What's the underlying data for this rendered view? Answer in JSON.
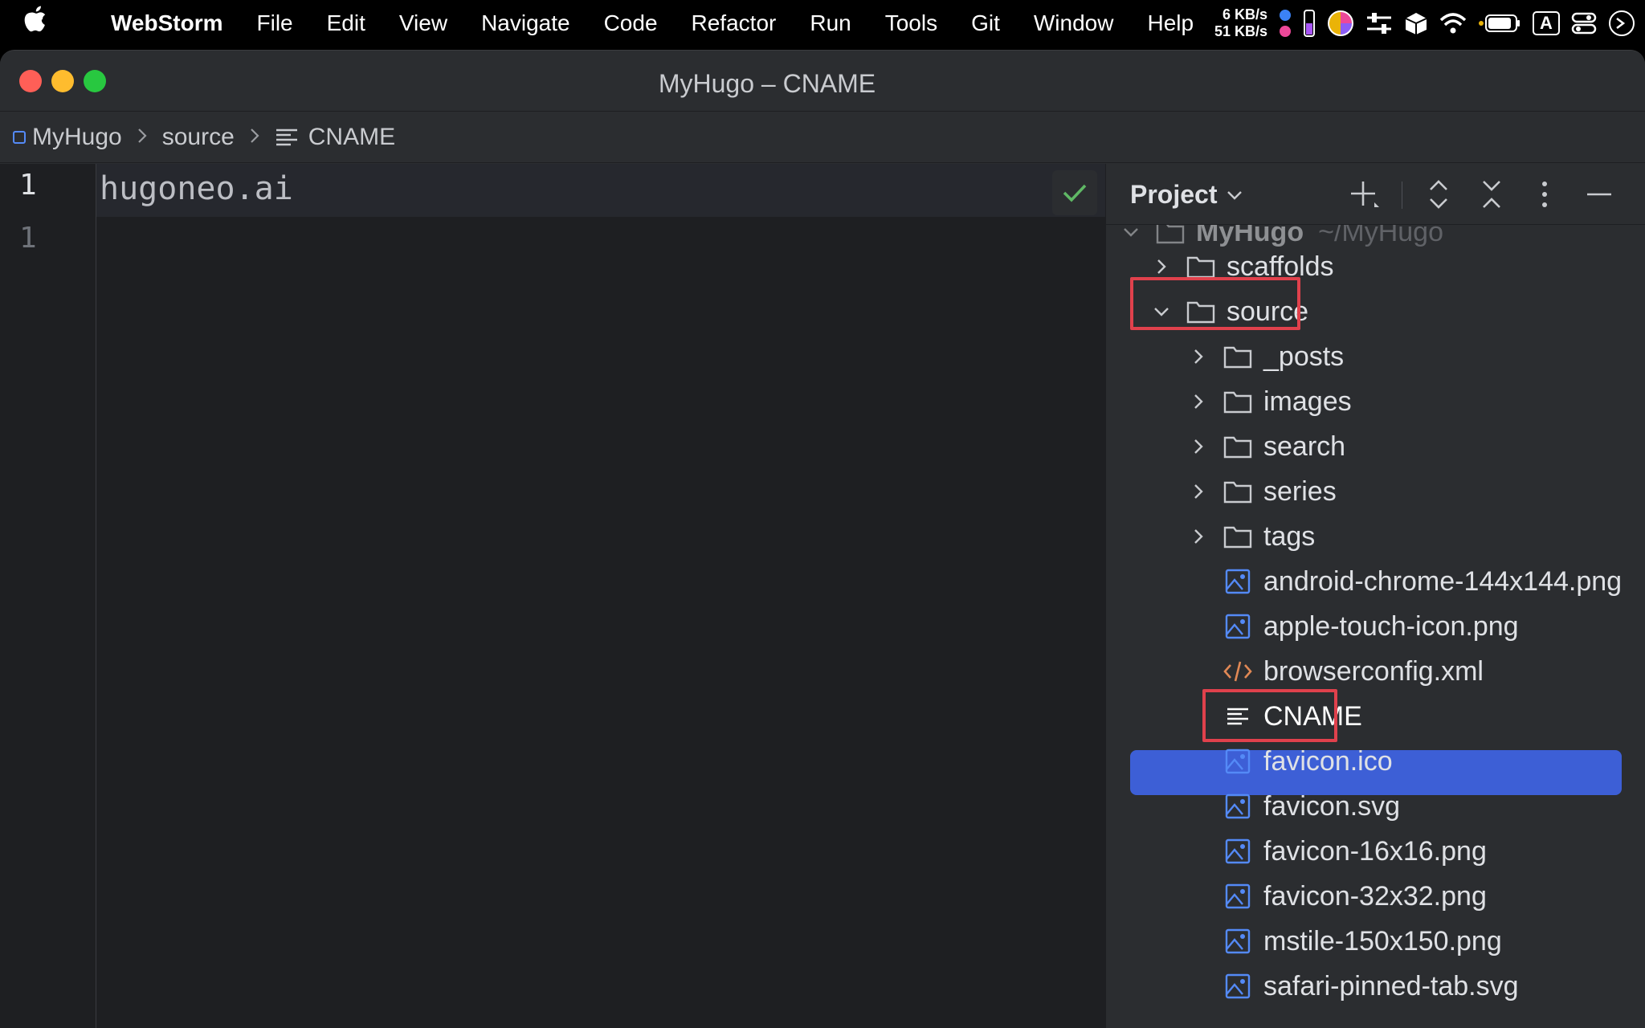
{
  "menubar": {
    "app_name": "WebStorm",
    "items": [
      "File",
      "Edit",
      "View",
      "Navigate",
      "Code",
      "Refactor",
      "Run",
      "Tools",
      "Git",
      "Window",
      "Help"
    ],
    "net_up": "6 KB/s",
    "net_down": "51 KB/s",
    "input_source": "A"
  },
  "window": {
    "title": "MyHugo – CNAME"
  },
  "breadcrumb": {
    "project": "MyHugo",
    "folder": "source",
    "file": "CNAME"
  },
  "editor": {
    "line_numbers": [
      "1",
      "1"
    ],
    "content": "hugoneo.ai"
  },
  "project_panel": {
    "title": "Project",
    "root_name": "MyHugo",
    "root_path": "~/MyHugo",
    "items": [
      {
        "label": "scaffolds",
        "type": "folder"
      },
      {
        "label": "source",
        "type": "folder"
      },
      {
        "label": "_posts",
        "type": "folder"
      },
      {
        "label": "images",
        "type": "folder"
      },
      {
        "label": "search",
        "type": "folder"
      },
      {
        "label": "series",
        "type": "folder"
      },
      {
        "label": "tags",
        "type": "folder"
      },
      {
        "label": "android-chrome-144x144.png",
        "type": "image"
      },
      {
        "label": "apple-touch-icon.png",
        "type": "image"
      },
      {
        "label": "browserconfig.xml",
        "type": "xml"
      },
      {
        "label": "CNAME",
        "type": "text"
      },
      {
        "label": "favicon.ico",
        "type": "image"
      },
      {
        "label": "favicon.svg",
        "type": "image"
      },
      {
        "label": "favicon-16x16.png",
        "type": "image"
      },
      {
        "label": "favicon-32x32.png",
        "type": "image"
      },
      {
        "label": "mstile-150x150.png",
        "type": "image"
      },
      {
        "label": "safari-pinned-tab.svg",
        "type": "image"
      }
    ]
  },
  "colors": {
    "selection": "#3d5fd6",
    "highlight_box": "#e0414c",
    "check": "#5fb865"
  }
}
